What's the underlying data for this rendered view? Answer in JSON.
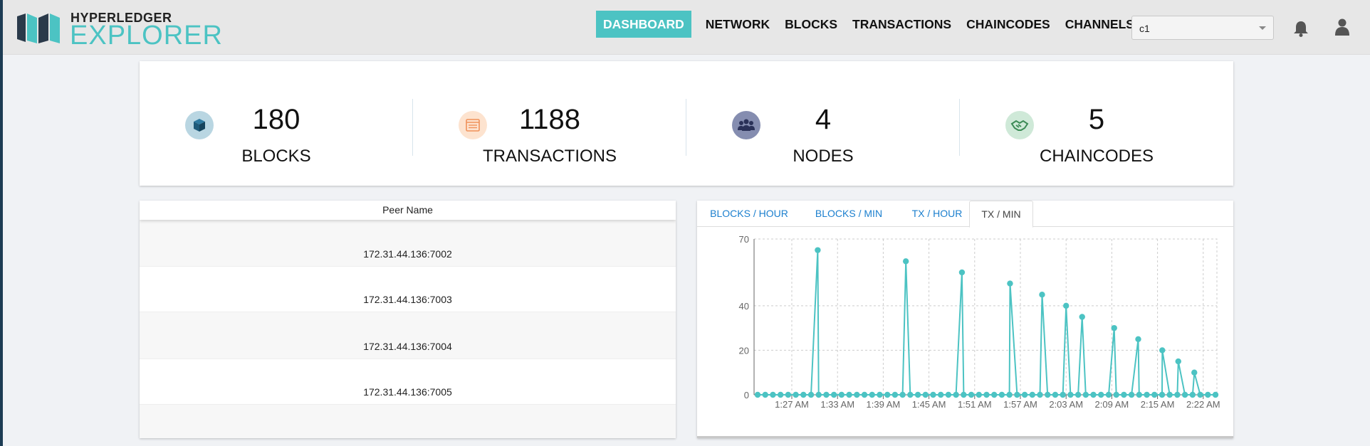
{
  "header": {
    "logo_top": "HYPERLEDGER",
    "logo_bottom": "EXPLORER",
    "nav": [
      {
        "label": "DASHBOARD",
        "active": true
      },
      {
        "label": "NETWORK",
        "active": false
      },
      {
        "label": "BLOCKS",
        "active": false
      },
      {
        "label": "TRANSACTIONS",
        "active": false
      },
      {
        "label": "CHAINCODES",
        "active": false
      },
      {
        "label": "CHANNELS",
        "active": false
      }
    ],
    "channel_select": {
      "value": "c1"
    }
  },
  "stats": [
    {
      "value": "180",
      "label": "BLOCKS",
      "icon": "cube-icon",
      "icon_bg": "#b9d6e2",
      "icon_color": "#1f5b7a"
    },
    {
      "value": "1188",
      "label": "TRANSACTIONS",
      "icon": "list-icon",
      "icon_bg": "#fde3cf",
      "icon_color": "#f0915a"
    },
    {
      "value": "4",
      "label": "NODES",
      "icon": "users-icon",
      "icon_bg": "#858db0",
      "icon_color": "#2a3158"
    },
    {
      "value": "5",
      "label": "CHAINCODES",
      "icon": "handshake-icon",
      "icon_bg": "#cfe9d8",
      "icon_color": "#3b8a55"
    }
  ],
  "peers": {
    "column_header": "Peer Name",
    "rows": [
      "172.31.44.136:7002",
      "172.31.44.136:7003",
      "172.31.44.136:7004",
      "172.31.44.136:7005",
      ""
    ]
  },
  "chart_tabs": [
    {
      "label": "BLOCKS / HOUR",
      "active": false
    },
    {
      "label": "BLOCKS / MIN",
      "active": false
    },
    {
      "label": "TX / HOUR",
      "active": false
    },
    {
      "label": "TX / MIN",
      "active": true
    }
  ],
  "colors": {
    "accent": "#4cc3c3",
    "tab_link": "#1b7fce",
    "line": "#4cc3c3"
  },
  "chart_data": {
    "type": "line",
    "xlabel": "",
    "ylabel": "",
    "ylim": [
      0,
      70
    ],
    "yticks": [
      0,
      20,
      40,
      70
    ],
    "x_tick_labels": [
      "1:27 AM",
      "1:33 AM",
      "1:39 AM",
      "1:45 AM",
      "1:51 AM",
      "1:57 AM",
      "2:03 AM",
      "2:09 AM",
      "2:15 AM",
      "2:22 AM"
    ],
    "grid": true,
    "series": [
      {
        "values": [
          0,
          0,
          0,
          0,
          0,
          0,
          0,
          0,
          0,
          0,
          0,
          0,
          0,
          0,
          0,
          0,
          0,
          0,
          0,
          0,
          0,
          0,
          0,
          0,
          0,
          0,
          0,
          0,
          0,
          0,
          0,
          0,
          0,
          0,
          0,
          0,
          0,
          0,
          0,
          0,
          0,
          0,
          0,
          0,
          0,
          0,
          0,
          0,
          0,
          0,
          0,
          0,
          0,
          0,
          0,
          0,
          0,
          0,
          0,
          0,
          0
        ],
        "peaks": [
          {
            "min_offset": 7.5,
            "value": 65
          },
          {
            "min_offset": 18.5,
            "value": 60
          },
          {
            "min_offset": 25.5,
            "value": 55
          },
          {
            "min_offset": 31.5,
            "value": 50
          },
          {
            "min_offset": 35.5,
            "value": 45
          },
          {
            "min_offset": 38.5,
            "value": 40
          },
          {
            "min_offset": 40.5,
            "value": 35
          },
          {
            "min_offset": 44.5,
            "value": 30
          },
          {
            "min_offset": 47.5,
            "value": 25
          },
          {
            "min_offset": 50.5,
            "value": 20
          },
          {
            "min_offset": 52.5,
            "value": 15
          },
          {
            "min_offset": 54.5,
            "value": 10
          }
        ]
      }
    ]
  }
}
